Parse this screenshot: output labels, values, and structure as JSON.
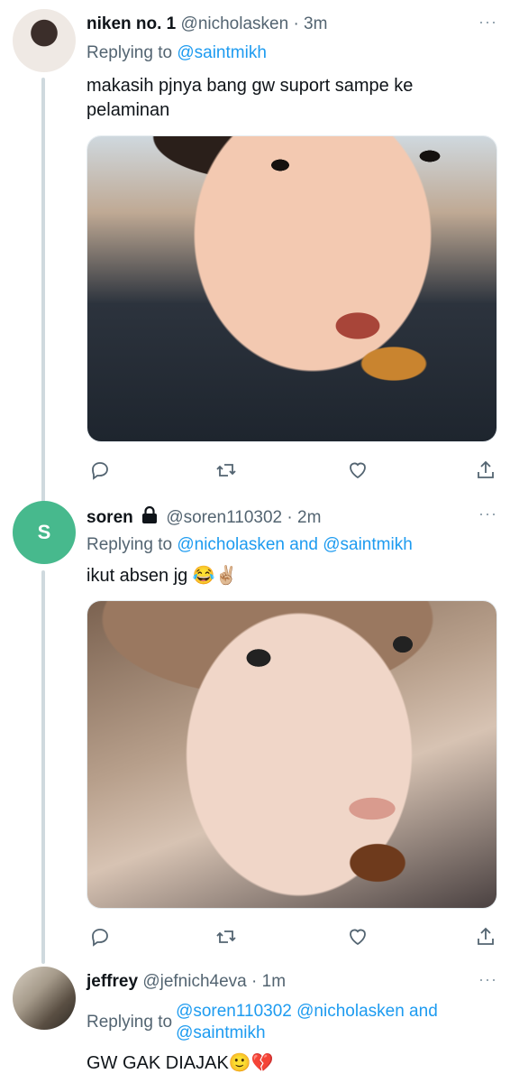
{
  "tweets": [
    {
      "name": "niken no. 1",
      "handle": "@nicholasken",
      "time": "· 3m",
      "replying_prefix": "Replying to ",
      "replying_to": "@saintmikh",
      "text": "makasih pjnya bang gw suport sampe ke pelaminan",
      "avatar": "photo"
    },
    {
      "name": "soren",
      "lock_icon": "lock-icon",
      "handle": "@soren110302",
      "time": "· 2m",
      "replying_prefix": "Replying to ",
      "replying_to": "@nicholasken and @saintmikh",
      "text": "ikut absen jg 😂✌🏼",
      "avatar_letter": "S"
    },
    {
      "name": "jeffrey",
      "handle": "@jefnich4eva",
      "time": "· 1m",
      "replying_prefix": "Replying to",
      "replying_to_line1": "@soren110302 @nicholasken and",
      "replying_to_line2": "@saintmikh",
      "text": "GW GAK DIAJAK🙂💔",
      "avatar": "photo"
    }
  ],
  "more_label": "···",
  "colors": {
    "link": "#1d9bf0",
    "secondary_text": "#536471",
    "thread_line": "#cfd9de",
    "avatar_s": "#47b98d"
  },
  "icons": [
    "reply-icon",
    "retweet-icon",
    "like-icon",
    "share-icon",
    "lock-icon"
  ]
}
